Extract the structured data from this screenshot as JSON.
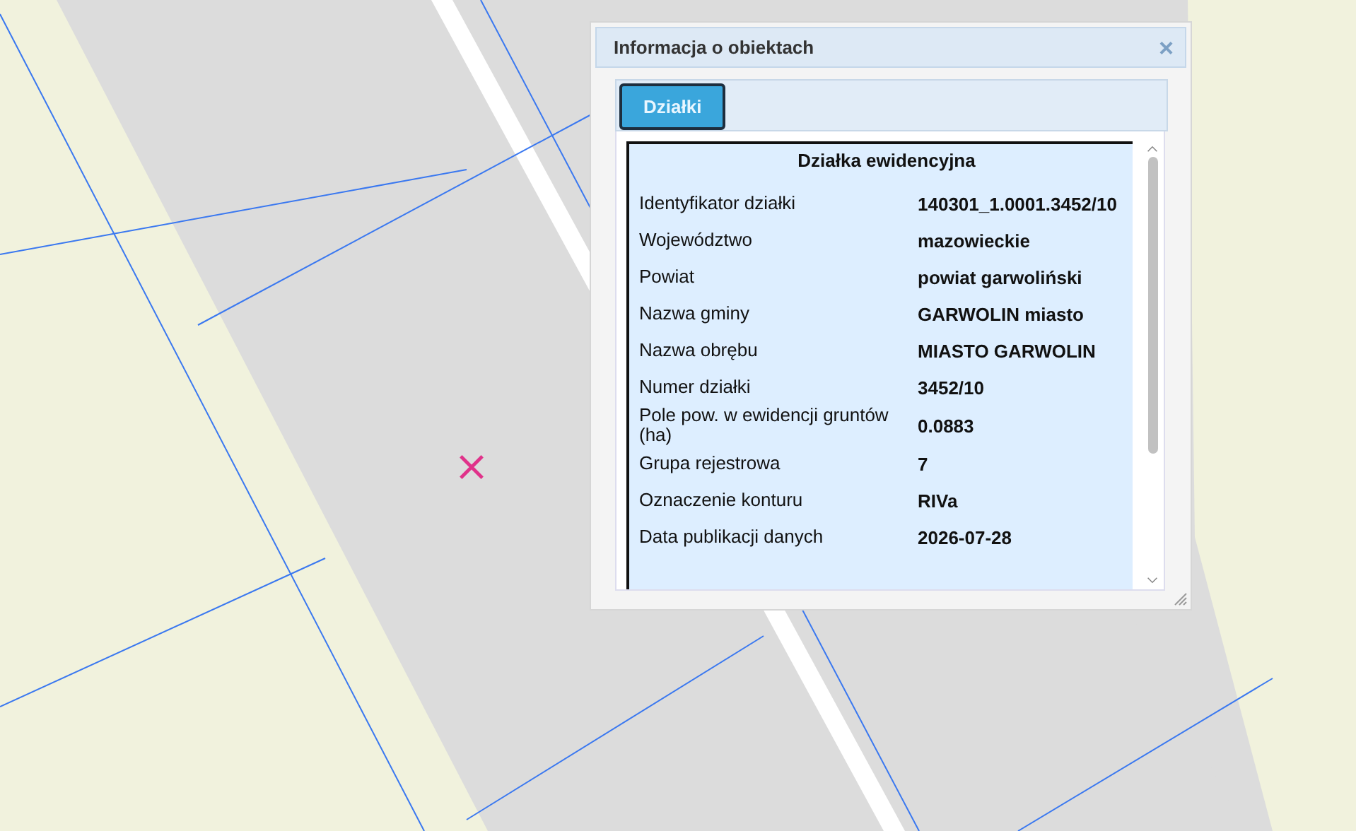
{
  "dialog": {
    "title": "Informacja o obiektach",
    "close": "×",
    "tabs": [
      {
        "label": "Działki",
        "selected": true
      }
    ],
    "table": {
      "heading": "Działka ewidencyjna",
      "rows": [
        {
          "label": "Identyfikator działki",
          "value": "140301_1.0001.3452/10"
        },
        {
          "label": "Województwo",
          "value": "mazowieckie"
        },
        {
          "label": "Powiat",
          "value": "powiat garwoliński"
        },
        {
          "label": "Nazwa gminy",
          "value": "GARWOLIN miasto"
        },
        {
          "label": "Nazwa obrębu",
          "value": "MIASTO GARWOLIN"
        },
        {
          "label": "Numer działki",
          "value": "3452/10"
        },
        {
          "label": "Pole pow. w ewidencji gruntów (ha)",
          "value": "0.0883"
        },
        {
          "label": "Grupa rejestrowa",
          "value": "7"
        },
        {
          "label": "Oznaczenie konturu",
          "value": "RIVa"
        },
        {
          "label": "Data publikacji danych",
          "value": "2026-07-28"
        }
      ]
    }
  }
}
